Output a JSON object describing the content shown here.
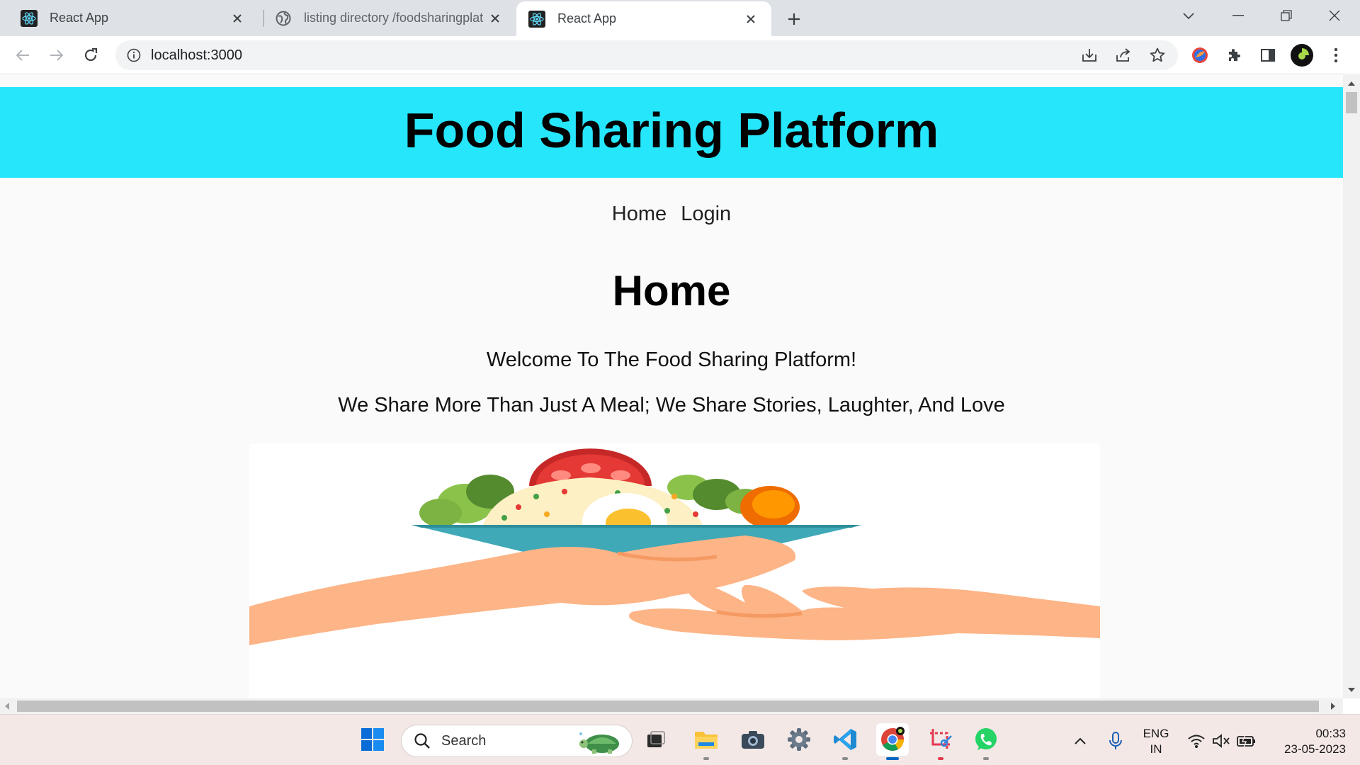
{
  "browser": {
    "tabs": [
      {
        "title": "React App",
        "favicon": "react-icon",
        "active": false
      },
      {
        "title": "listing directory /foodsharingplat",
        "favicon": "globe-icon",
        "active": false
      },
      {
        "title": "React App",
        "favicon": "react-icon",
        "active": true
      }
    ],
    "address": "localhost:3000"
  },
  "page": {
    "header_title": "Food Sharing Platform",
    "nav": {
      "home": "Home",
      "login": "Login"
    },
    "heading": "Home",
    "welcome": "Welcome To The Food Sharing Platform!",
    "tagline": "We Share More Than Just A Meal; We Share Stories, Laughter, And Love",
    "hero_image": "food-sharing-illustration",
    "header_color": "#26e6fc"
  },
  "taskbar": {
    "search_label": "Search",
    "apps": [
      "start-icon",
      "task-view-icon",
      "file-explorer-icon",
      "camera-icon",
      "settings-icon",
      "vscode-icon",
      "chrome-icon",
      "snipping-tool-icon",
      "whatsapp-icon"
    ],
    "lang_line1": "ENG",
    "lang_line2": "IN",
    "time": "00:33",
    "date": "23-05-2023"
  }
}
